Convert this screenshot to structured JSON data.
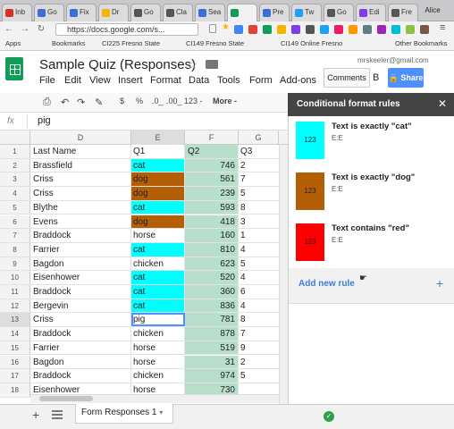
{
  "browser": {
    "tabs": [
      {
        "label": "Inb",
        "color": "#d93025"
      },
      {
        "label": "Go",
        "color": "#3b6ed8"
      },
      {
        "label": "Fix",
        "color": "#3b6ed8"
      },
      {
        "label": "Dr",
        "color": "#f4b400"
      },
      {
        "label": "Go",
        "color": "#555"
      },
      {
        "label": "Cla",
        "color": "#555"
      },
      {
        "label": "Sea",
        "color": "#3b6ed8"
      },
      {
        "label": "",
        "color": "#0f9d58"
      },
      {
        "label": "Pre",
        "color": "#3b6ed8"
      },
      {
        "label": "Tw",
        "color": "#1da1f2"
      },
      {
        "label": "Go",
        "color": "#555"
      },
      {
        "label": "Edi",
        "color": "#7b3fe4"
      },
      {
        "label": "Fre",
        "color": "#555"
      }
    ],
    "profile": "Alice",
    "url": "https://docs.google.com/s...",
    "bookmarks": [
      "Apps",
      "Bookmarks",
      "CI225 Fresno State",
      "CI149 Fresno State",
      "CI149 Online Fresno",
      "Other Bookmarks"
    ]
  },
  "doc": {
    "title": "Sample Quiz (Responses)",
    "menus": [
      "File",
      "Edit",
      "View",
      "Insert",
      "Format",
      "Data",
      "Tools",
      "Form",
      "Add-ons"
    ],
    "email": "mrskeeler@gmail.com",
    "comments_label": "Comments",
    "share_label": "Share",
    "share_prefix": "B"
  },
  "toolbar": {
    "items": [
      "$",
      "%",
      ".0_",
      ".00_",
      "123 -",
      "More -"
    ]
  },
  "formula": {
    "label": "fx",
    "value": "pig"
  },
  "grid": {
    "columns": [
      "D",
      "E",
      "F",
      "G"
    ],
    "rows": [
      {
        "n": "1",
        "d": "Last Name",
        "e": "Q1",
        "f": "Q2",
        "g": "Q3",
        "fill": ""
      },
      {
        "n": "2",
        "d": "Brassfield",
        "e": "cat",
        "f": "746",
        "g": "2",
        "fill": "#00ffff"
      },
      {
        "n": "3",
        "d": "Criss",
        "e": "dog",
        "f": "561",
        "g": "7",
        "fill": "#b45f06"
      },
      {
        "n": "4",
        "d": "Criss",
        "e": "dog",
        "f": "239",
        "g": "5",
        "fill": "#b45f06"
      },
      {
        "n": "5",
        "d": "Blythe",
        "e": "cat",
        "f": "593",
        "g": "8",
        "fill": "#00ffff"
      },
      {
        "n": "6",
        "d": "Evens",
        "e": "dog",
        "f": "418",
        "g": "3",
        "fill": "#b45f06"
      },
      {
        "n": "7",
        "d": "Braddock",
        "e": "horse",
        "f": "160",
        "g": "1",
        "fill": ""
      },
      {
        "n": "8",
        "d": "Farrier",
        "e": "cat",
        "f": "810",
        "g": "4",
        "fill": "#00ffff"
      },
      {
        "n": "9",
        "d": "Bagdon",
        "e": "chicken",
        "f": "623",
        "g": "5",
        "fill": ""
      },
      {
        "n": "10",
        "d": "Eisenhower",
        "e": "cat",
        "f": "520",
        "g": "4",
        "fill": "#00ffff"
      },
      {
        "n": "11",
        "d": "Braddock",
        "e": "cat",
        "f": "360",
        "g": "6",
        "fill": "#00ffff"
      },
      {
        "n": "12",
        "d": "Bergevin",
        "e": "cat",
        "f": "836",
        "g": "4",
        "fill": "#00ffff"
      },
      {
        "n": "13",
        "d": "Criss",
        "e": "pig",
        "f": "781",
        "g": "8",
        "fill": ""
      },
      {
        "n": "14",
        "d": "Braddock",
        "e": "chicken",
        "f": "878",
        "g": "7",
        "fill": ""
      },
      {
        "n": "15",
        "d": "Farrier",
        "e": "horse",
        "f": "519",
        "g": "9",
        "fill": ""
      },
      {
        "n": "16",
        "d": "Bagdon",
        "e": "horse",
        "f": "31",
        "g": "2",
        "fill": ""
      },
      {
        "n": "17",
        "d": "Braddock",
        "e": "chicken",
        "f": "974",
        "g": "5",
        "fill": ""
      },
      {
        "n": "18",
        "d": "Eisenhower",
        "e": "horse",
        "f": "730",
        "g": "",
        "fill": ""
      }
    ]
  },
  "panel": {
    "title": "Conditional format rules",
    "rules": [
      {
        "label": "Text is exactly \"cat\"",
        "range": "E:E",
        "swatch": "123",
        "color": "#00ffff"
      },
      {
        "label": "Text is exactly \"dog\"",
        "range": "E:E",
        "swatch": "123",
        "color": "#b45f06"
      },
      {
        "label": "Text contains \"red\"",
        "range": "E:E",
        "swatch": "123",
        "color": "#ff0000"
      }
    ],
    "add_label": "Add new rule",
    "add_plus": "+"
  },
  "footer": {
    "sheet_name": "Form Responses 1",
    "add": "+"
  }
}
